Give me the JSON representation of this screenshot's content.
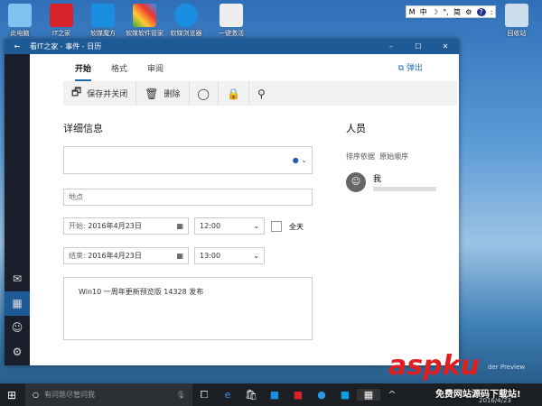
{
  "desktop": {
    "icons": [
      "此电脑",
      "IT之家",
      "软媒魔方",
      "软媒软件管家",
      "软媒浏览器",
      "一键激活"
    ],
    "recycle_bin": "回收站"
  },
  "ime_tray": [
    "M",
    "中",
    "☽",
    "°,",
    "简",
    "⚙",
    "?",
    ":"
  ],
  "window": {
    "title": "看IT之家 - 事件 - 日历",
    "back": "←",
    "minimize": "–",
    "maximize": "☐",
    "close": "✕"
  },
  "tabs": [
    "开始",
    "格式",
    "审阅"
  ],
  "popout": "弹出",
  "toolbar": {
    "save_close": "保存并关闭",
    "delete": "删除"
  },
  "details": {
    "heading": "详细信息",
    "title_value": "",
    "location_placeholder": "地点",
    "start_label": "开始:",
    "start_date": "2016年4月23日",
    "start_time": "12:00",
    "allday": "全天",
    "end_label": "结束:",
    "end_date": "2016年4月23日",
    "end_time": "13:00",
    "body": "Win10 一周年更新预览版 14328 发布"
  },
  "people": {
    "heading": "人员",
    "sort_label": "排序依据",
    "sort_value": "原始顺序",
    "me": "我"
  },
  "taskbar": {
    "search_placeholder": "有问题尽管问我",
    "date": "2016/4/23"
  },
  "watermark": {
    "logo": "aspku",
    "tagline": "免费网站源码下载站!",
    "preview": "der Preview"
  },
  "colors": {
    "accent": "#1e6ab0",
    "titlebar": "#1e5a96"
  }
}
